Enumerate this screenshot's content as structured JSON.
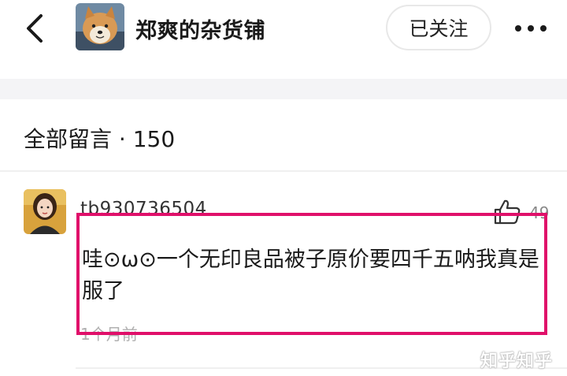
{
  "header": {
    "back_icon": "chevron-left-icon",
    "shop_avatar_icon": "shiba-dog-avatar",
    "shop_name": "郑爽的杂货铺",
    "follow_label": "已关注",
    "more_icon": "more-dots-icon"
  },
  "comments_section": {
    "title": "全部留言 · 150"
  },
  "comment": {
    "avatar_icon": "user-avatar",
    "username": "tb930736504",
    "like_icon": "thumbs-up-icon",
    "like_count": "49",
    "text": "哇⊙ω⊙一个无印良品被子原价要四千五呐我真是服了",
    "time": "1个月前"
  },
  "watermark": "知乎知乎",
  "colors": {
    "highlight": "#e0106a",
    "band": "#f4f4f6",
    "muted": "#b0b0b0"
  }
}
